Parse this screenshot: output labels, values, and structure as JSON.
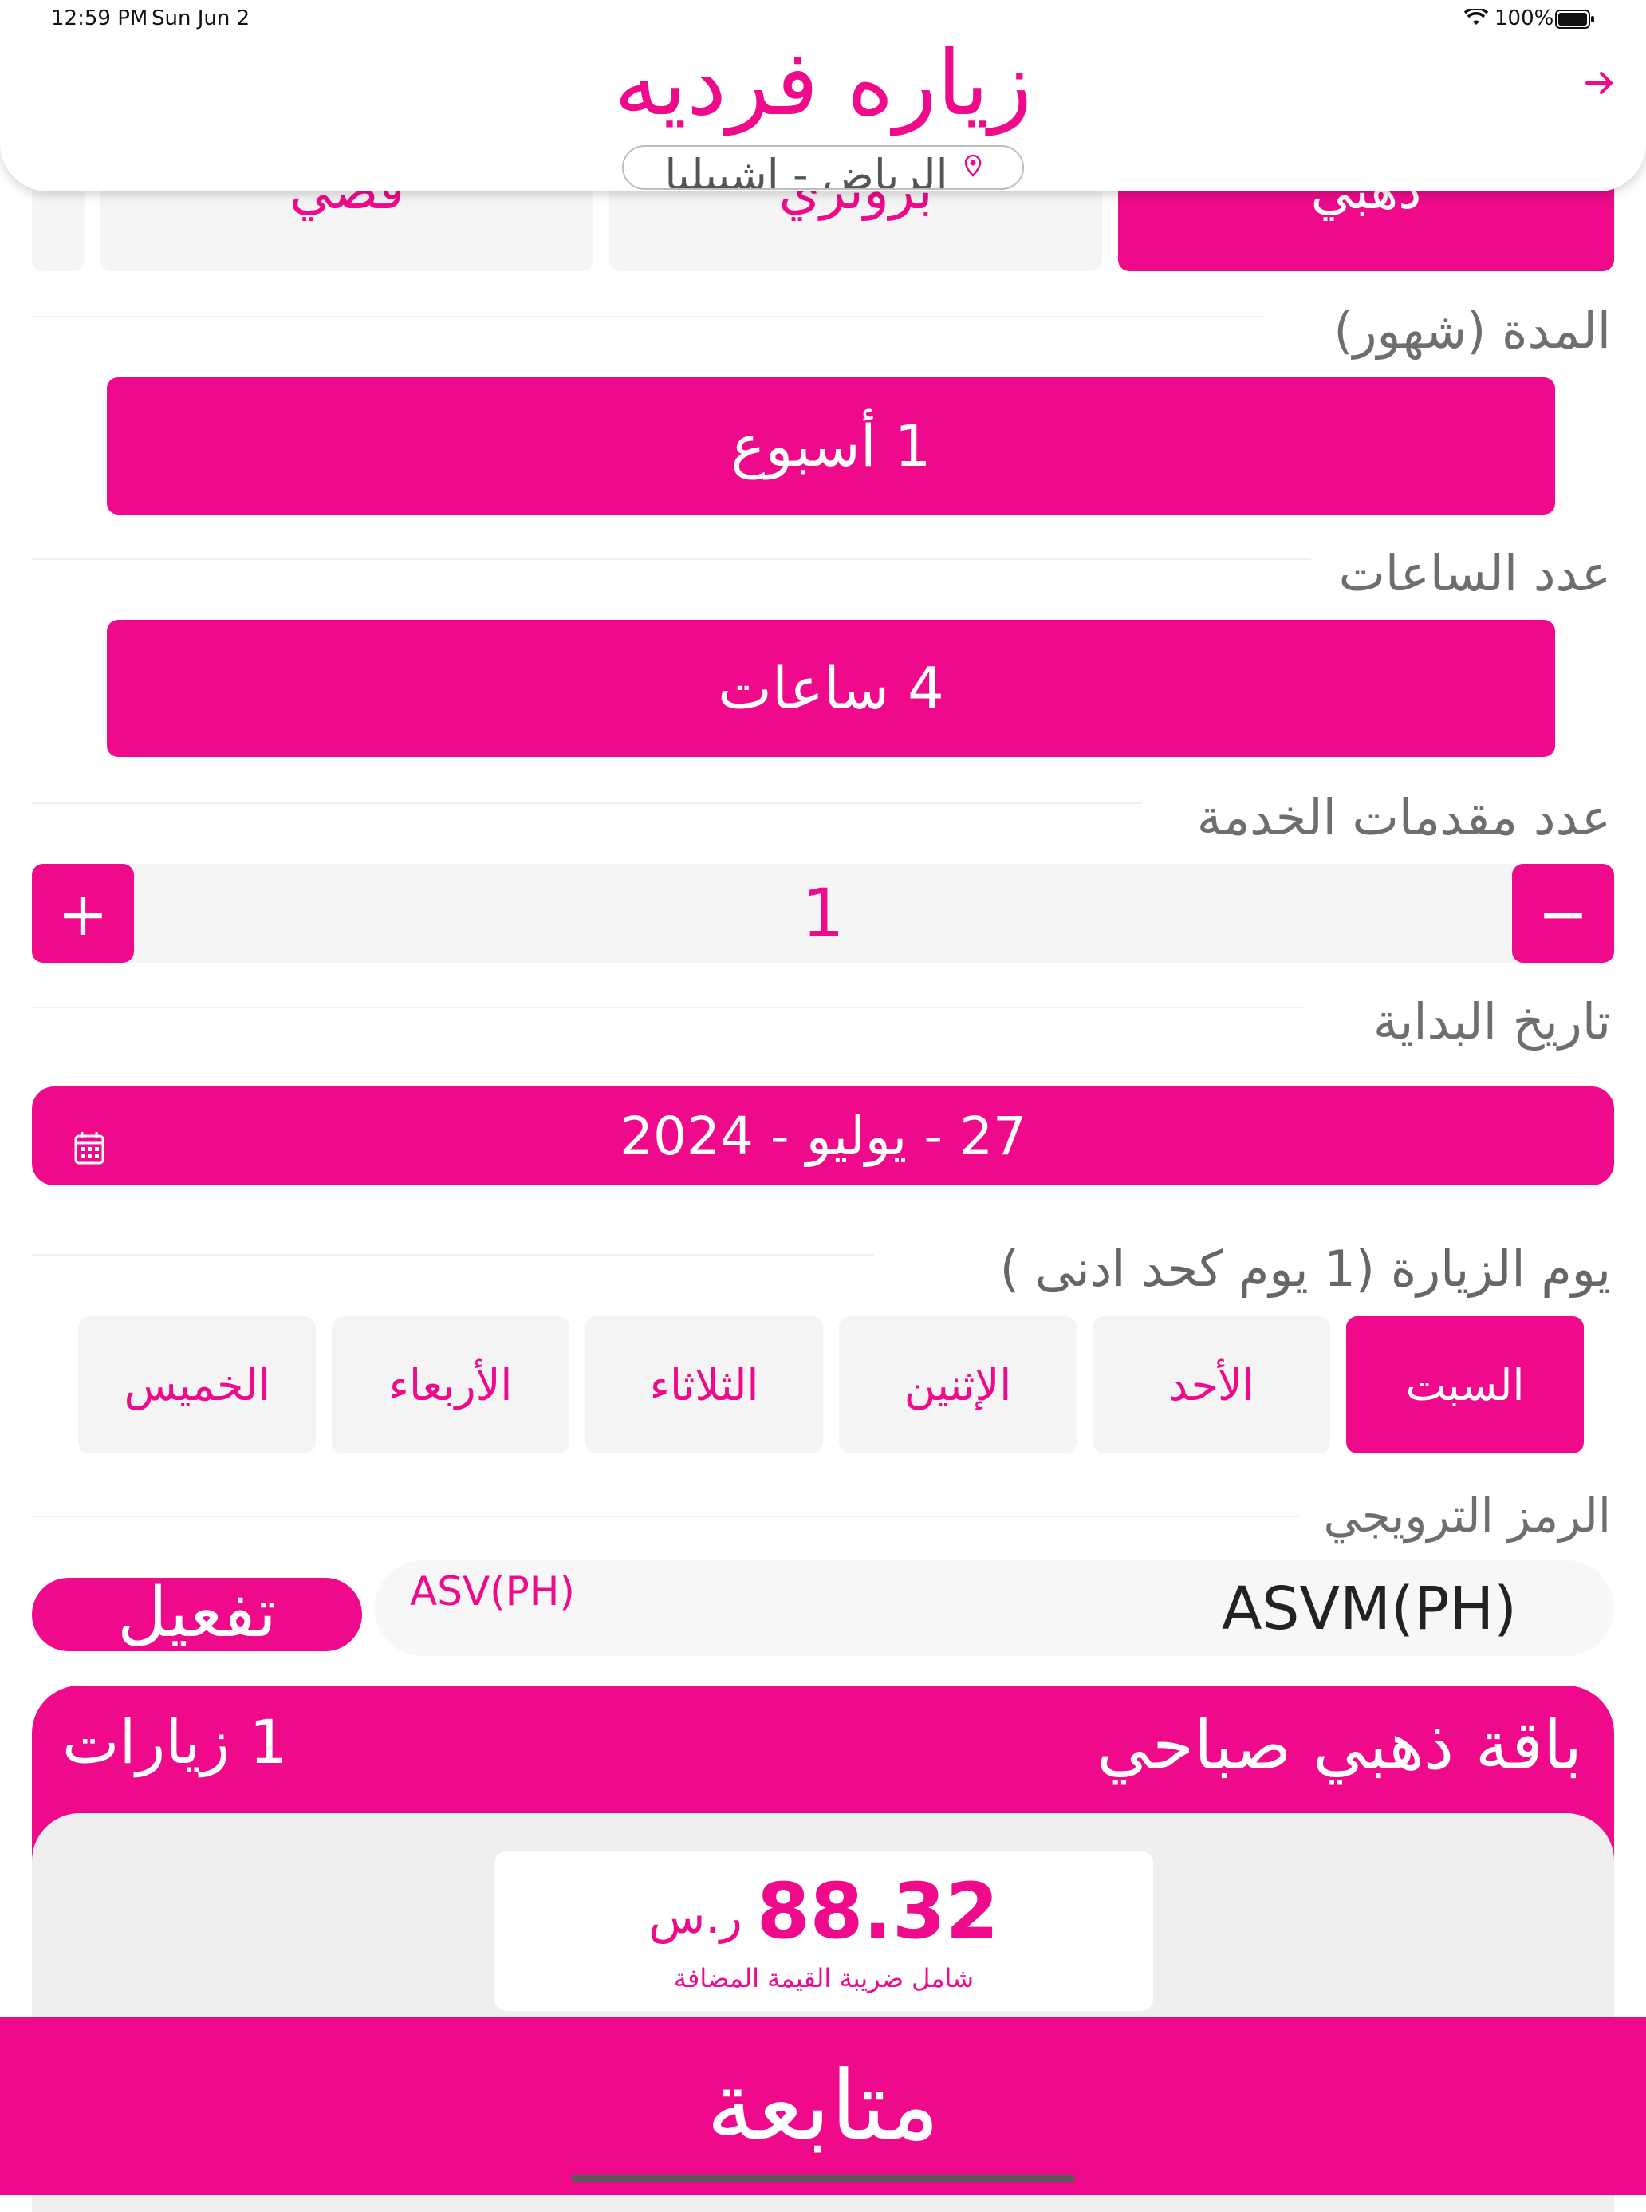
{
  "status_bar": {
    "time": "12:59 PM",
    "date": "Sun Jun 2",
    "battery": "100%"
  },
  "header": {
    "title": "زياره فرديه",
    "location": "الرياض - اشبيليا",
    "back_icon": "arrow-right-icon",
    "location_icon": "pin-icon"
  },
  "tiers": [
    {
      "label": "ذهبي",
      "selected": true
    },
    {
      "label": "برونزي",
      "selected": false
    },
    {
      "label": "فضي",
      "selected": false
    }
  ],
  "duration": {
    "label": "المدة (شهور)",
    "value": "1 أسبوع"
  },
  "hours": {
    "label": "عدد الساعات",
    "value": "4 ساعات"
  },
  "providers": {
    "label": "عدد مقدمات الخدمة",
    "value": "1",
    "plus": "+",
    "minus": "−"
  },
  "start_date": {
    "label": "تاريخ البداية",
    "value": "27 - يوليو - 2024",
    "icon": "calendar-icon"
  },
  "visit_days": {
    "label": "يوم الزيارة",
    "note": "(1 يوم كحد ادنى  )",
    "days": [
      {
        "label": "السبت",
        "selected": true
      },
      {
        "label": "الأحد",
        "selected": false
      },
      {
        "label": "الإثنين",
        "selected": false
      },
      {
        "label": "الثلاثاء",
        "selected": false
      },
      {
        "label": "الأربعاء",
        "selected": false
      },
      {
        "label": "الخميس",
        "selected": false
      }
    ]
  },
  "promo": {
    "label": "الرمز الترويجي",
    "code": "ASVM(PH)",
    "hint": "ASV(PH)",
    "activate": "تفعيل"
  },
  "package": {
    "name": "باقة ذهبي صباحي",
    "visits": "1 زيارات",
    "price": "88.32",
    "currency": "ر.س",
    "vat_note": "شامل ضريبة القيمة المضافة"
  },
  "continue_label": "متابعة",
  "colors": {
    "accent": "#ee0a8b",
    "light_gray": "#f5f5f5",
    "label_gray": "#6e6e6e"
  }
}
